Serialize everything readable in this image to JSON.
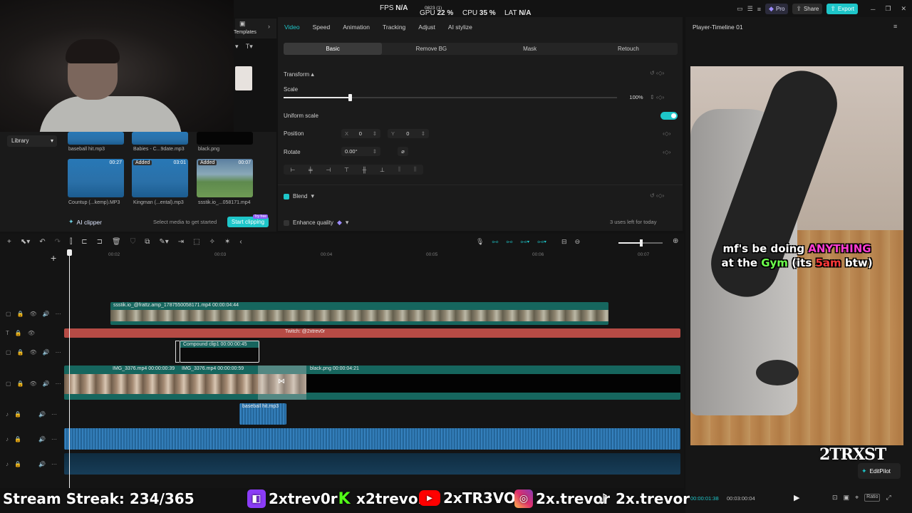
{
  "topbar": {
    "fps_label": "FPS",
    "fps_value": "N/A",
    "gpu_top": "0823 (1)",
    "gpu_label": "GPU",
    "gpu_value": "22 %",
    "cpu_label": "CPU",
    "cpu_value": "35 %",
    "lat_label": "LAT",
    "lat_value": "N/A",
    "pro_label": "Pro",
    "share_label": "Share",
    "export_label": "Export"
  },
  "media": {
    "templates_label": "Templates",
    "library_label": "Library",
    "items": [
      {
        "name": "baseball hit.mp3"
      },
      {
        "name": "Babies - C...9date.mp3"
      },
      {
        "name": "black.png"
      },
      {
        "name": "Countup (...kemp).MP3",
        "duration": "00:27"
      },
      {
        "name": "Kingman (...ental).mp3",
        "duration": "03:01",
        "badge": "Added"
      },
      {
        "name": "ssstik.io_...058171.mp4",
        "duration": "00:07",
        "badge": "Added"
      }
    ],
    "ai_clipper_label": "AI clipper",
    "ai_hint": "Select media to get started",
    "start_clipping_label": "Start clipping",
    "try_free": "Try free"
  },
  "properties": {
    "tabs": [
      "Video",
      "Speed",
      "Animation",
      "Tracking",
      "Adjust",
      "AI stylize"
    ],
    "active_tab": "Video",
    "subtabs": [
      "Basic",
      "Remove BG",
      "Mask",
      "Retouch"
    ],
    "transform_label": "Transform",
    "scale_label": "Scale",
    "scale_value": "100%",
    "uniform_scale_label": "Uniform scale",
    "position_label": "Position",
    "pos_x_label": "X",
    "pos_x": "0",
    "pos_y_label": "Y",
    "pos_y": "0",
    "rotate_label": "Rotate",
    "rotate_value": "0.00°",
    "blend_label": "Blend",
    "enhance_label": "Enhance quality",
    "uses_left": "3 uses left for today"
  },
  "player": {
    "title": "Player-Timeline 01",
    "caption_line1": [
      "mf's be doing ",
      "ANYTHING"
    ],
    "caption_line2": [
      "at the ",
      "Gym",
      " (its ",
      "5am",
      " btw)"
    ],
    "current_time": "00:00:01:38",
    "total_time": "00:03:00:04",
    "editpilot_label": "EditPilot",
    "watermark": "2TRXST",
    "ratio_label": "Ratio"
  },
  "timeline": {
    "ruler": [
      "00:02",
      "00:03",
      "00:04",
      "00:05",
      "00:06",
      "00:07"
    ],
    "clips": {
      "top_video": "ssstik.io_@frattz.amp_1787550058171.mp4  00:00:04:44",
      "text_clip": "Twitch: @2xtrev0r",
      "compound": "Compound clip1  00:00:00:45",
      "main1": "IMG_3376.mp4  00:00:00:39",
      "main2": "IMG_3376.mp4  00:00:00:59",
      "black": "black.png  00:00:04:21",
      "audio1": "baseball hit.mp3"
    }
  },
  "stream": {
    "streak": "Stream Streak: 234/365",
    "twitch": "2xtrev0r",
    "kick": "x2trevor",
    "youtube": "2xTR3VOR",
    "instagram": "2x.trevor",
    "tiktok": "2x.trevor"
  }
}
